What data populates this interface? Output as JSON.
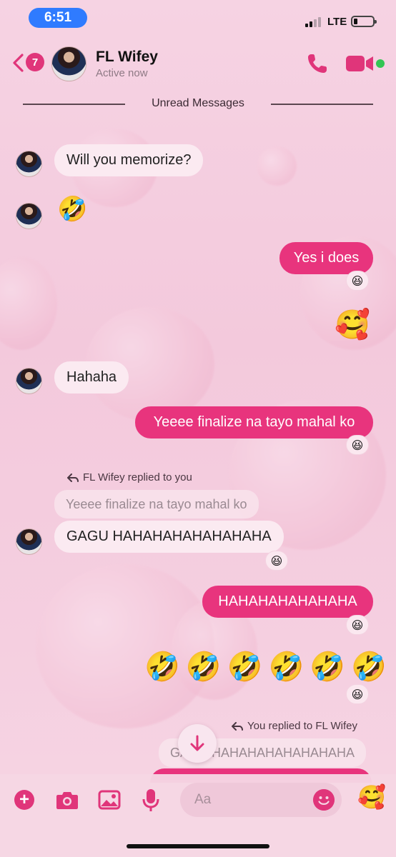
{
  "status_bar": {
    "time": "6:51",
    "network": "LTE",
    "battery_icon": "battery-low-icon"
  },
  "header": {
    "back_count": "7",
    "contact_name": "FL Wifey",
    "status": "Active now",
    "call_icon": "phone-icon",
    "video_icon": "video-camera-icon",
    "accent_color": "#e0357a"
  },
  "divider": {
    "label": "Unread Messages"
  },
  "messages": [
    {
      "from": "them",
      "type": "text",
      "text": "Will you memorize?"
    },
    {
      "from": "them",
      "type": "emoji",
      "text": "🤣"
    },
    {
      "from": "me",
      "type": "text",
      "text": "Yes i does",
      "reaction": "😆"
    },
    {
      "from": "me",
      "type": "emoji",
      "text": "🥰"
    },
    {
      "from": "them",
      "type": "text",
      "text": "Hahaha"
    },
    {
      "from": "me",
      "type": "text",
      "text": "Yeeee finalize na tayo mahal ko",
      "reaction": "😆"
    },
    {
      "from": "them",
      "type": "reply",
      "reply_note": "FL Wifey replied to you",
      "quoted": "Yeeee finalize na tayo mahal ko",
      "text": "GAGU HAHAHAHAHAHAHAHA",
      "reaction": "😆"
    },
    {
      "from": "me",
      "type": "text",
      "text": "HAHAHAHAHAHAHA",
      "reaction": "😆"
    },
    {
      "from": "me",
      "type": "emoji-row",
      "emojis": [
        "🤣",
        "🤣",
        "🤣",
        "🤣",
        "🤣",
        "🤣"
      ],
      "reaction": "😆"
    },
    {
      "from": "me",
      "type": "reply",
      "reply_note": "You replied to FL Wifey",
      "quoted": "GAGU HAHAHAHAHAHAHAHA"
    }
  ],
  "composer": {
    "placeholder": "Aa",
    "quick_reaction": "🥰",
    "icons": [
      "plus-icon",
      "camera-icon",
      "image-icon",
      "microphone-icon",
      "emoji-smile-icon"
    ]
  },
  "colors": {
    "outgoing_bubble": "#e8347d",
    "incoming_bubble": "#fbeaf1",
    "online": "#33c553"
  }
}
